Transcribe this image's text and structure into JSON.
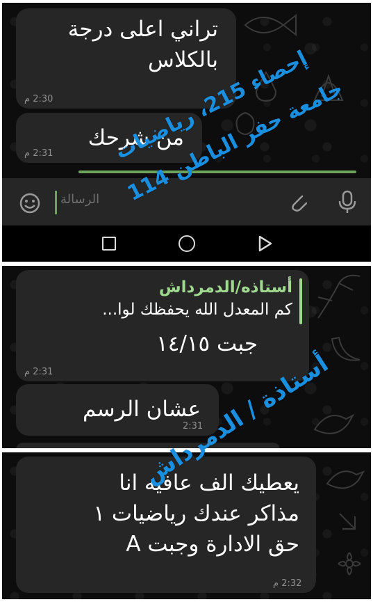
{
  "panel1": {
    "messages": [
      {
        "text_lines": [
          "تراني اعلى درجة",
          "بالكلاس"
        ],
        "time": "2:30 م"
      },
      {
        "text_lines": [
          "من شرحك"
        ],
        "time": "2:31 م"
      }
    ],
    "input_placeholder": "الرسالة"
  },
  "panel2": {
    "reply": {
      "sender": "أستاذه/الدمرداش",
      "quoted_text": "كم المعدل الله يحفظك لوا...",
      "message_text": "جبت ١٤/١٥",
      "time": "2:31 م"
    },
    "message": {
      "text": "عشان الرسم",
      "time": "2:31"
    }
  },
  "panel3": {
    "message": {
      "text_lines": [
        "يعطيك الف عافيه انا",
        "مذاكر عندك رياضيات ١",
        "حق الادارة وجبت A"
      ],
      "time": "2:32 م"
    }
  },
  "watermarks": {
    "line1": "إحصاء 215، رياضيات",
    "line2": "جامعة حفر الباطن 114",
    "teacher": "أستاذة / الدمرداش"
  },
  "colors": {
    "bubble": "#262626",
    "background": "#0d0d0d",
    "sender_green": "#9fd88f",
    "watermark_blue": "#1a8fe0"
  }
}
